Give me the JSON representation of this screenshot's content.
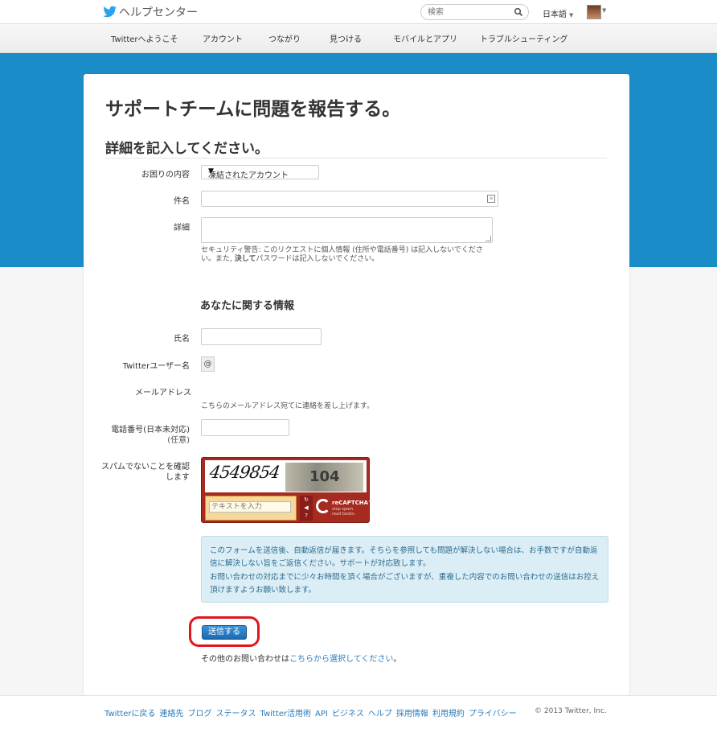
{
  "header": {
    "site_title": "ヘルプセンター",
    "search_placeholder": "検索",
    "language": "日本語"
  },
  "nav": {
    "items": [
      "Twitterへようこそ",
      "アカウント",
      "つながり",
      "見つける",
      "モバイルとアプリ",
      "トラブルシューティング"
    ]
  },
  "form": {
    "title": "サポートチームに問題を報告する。",
    "section_heading": "詳細を記入してください。",
    "issue_label": "お困りの内容",
    "issue_value": "凍結されたアカウント",
    "subject_label": "件名",
    "details_label": "詳細",
    "security_note_pre": "セキュリティ警告: このリクエストに個人情報 (住所や電話番号) は記入しないでください。また, ",
    "security_note_bold": "決して",
    "security_note_post": "パスワードは記入しないでください。",
    "about_heading": "あなたに関する情報",
    "name_label": "氏名",
    "twitter_label": "Twitterユーザー名",
    "at_symbol": "@",
    "email_label": "メールアドレス",
    "email_note": "こちらのメールアドレス宛てに連絡を差し上げます。",
    "phone_label_line1": "電話番号(日本未対応)",
    "phone_label_line2": "(任意)",
    "spam_label_line1": "スパムでないことを確認",
    "spam_label_line2": "します",
    "captcha_word1": "4549854",
    "captcha_word2": "104",
    "captcha_placeholder": "テキストを入力",
    "captcha_brand": "reCAPTCHA™",
    "captcha_tagline": "stop spam. read books.",
    "info_paragraph1": "このフォームを送信後、自動返信が届きます。そちらを参照しても問題が解決しない場合は、お手数ですが自動返信に解決しない旨をご返信ください。サポートが対応致します。",
    "info_paragraph2": "お問い合わせの対応までに少々お時間を頂く場合がございますが、重複した内容でのお問い合わせの送信はお控え頂けますようお願い致します。",
    "submit_label": "送信する",
    "other_contact_text": "その他のお問い合わせは",
    "other_contact_link": "こちらから選択してください",
    "other_contact_end": "。"
  },
  "footer": {
    "links": [
      "Twitterに戻る",
      "連絡先",
      "ブログ",
      "ステータス",
      "Twitter活用術",
      "API",
      "ビジネス",
      "ヘルプ",
      "採用情報",
      "利用規約",
      "プライバシー"
    ],
    "copyright": "© 2013 Twitter, Inc."
  }
}
